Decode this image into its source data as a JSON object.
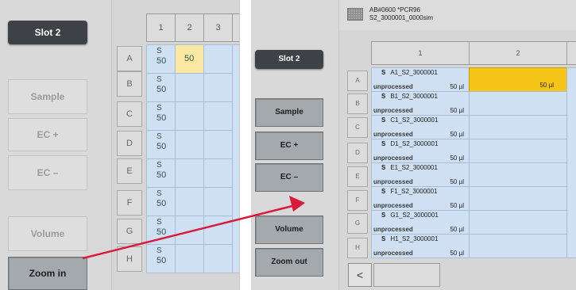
{
  "left": {
    "slot_label": "Slot 2",
    "buttons": {
      "sample": "Sample",
      "ec_plus": "EC +",
      "ec_minus": "EC –",
      "volume": "Volume",
      "zoom_in": "Zoom in"
    },
    "columns": [
      "1",
      "2",
      "3"
    ],
    "rows": [
      "A",
      "B",
      "C",
      "D",
      "E",
      "F",
      "G",
      "H"
    ],
    "cell_sample_letter": "S",
    "cell_volume": "50",
    "selected_value": "50"
  },
  "right": {
    "plate_id": "AB#0600 *PCR96",
    "plate_name": "S2_3000001_0000sim",
    "slot_label": "Slot 2",
    "buttons": {
      "sample": "Sample",
      "ec_plus": "EC +",
      "ec_minus": "EC –",
      "volume": "Volume",
      "zoom_out": "Zoom out"
    },
    "columns": [
      "1",
      "2"
    ],
    "rows": [
      "A",
      "B",
      "C",
      "D",
      "E",
      "F",
      "G",
      "H"
    ],
    "cells": [
      {
        "sample": "A1_S2_3000001",
        "status": "unprocessed",
        "volume": "50 µl"
      },
      {
        "sample": "B1_S2_3000001",
        "status": "unprocessed",
        "volume": "50 µl"
      },
      {
        "sample": "C1_S2_3000001",
        "status": "unprocessed",
        "volume": "50 µl"
      },
      {
        "sample": "D1_S2_3000001",
        "status": "unprocessed",
        "volume": "50 µl"
      },
      {
        "sample": "E1_S2_3000001",
        "status": "unprocessed",
        "volume": "50 µl"
      },
      {
        "sample": "F1_S2_3000001",
        "status": "unprocessed",
        "volume": "50 µl"
      },
      {
        "sample": "G1_S2_3000001",
        "status": "unprocessed",
        "volume": "50 µl"
      },
      {
        "sample": "H1_S2_3000001",
        "status": "unprocessed",
        "volume": "50 µl"
      }
    ],
    "type_letter": "S",
    "selected_value": "50 µl",
    "scroll_left_glyph": "<"
  },
  "colors": {
    "cell": "#cfe0f3",
    "selected_left": "#fbe9a3",
    "selected_right": "#f5c518",
    "arrow": "#d81b3a",
    "slot_bg": "#3e4246"
  }
}
